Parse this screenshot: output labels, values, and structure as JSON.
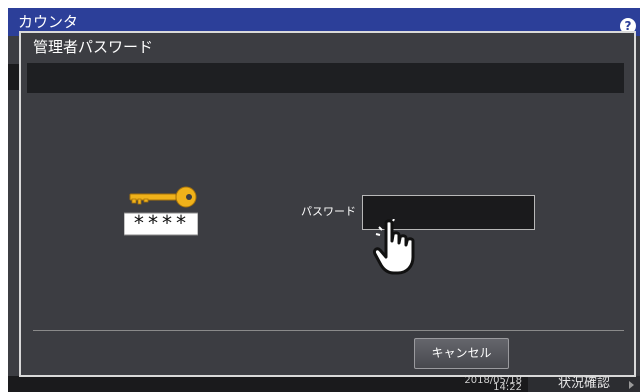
{
  "background": {
    "title": "カウンタ",
    "help_label": "?",
    "status": {
      "date": "2018/05/18",
      "time": "14:22",
      "check_label": "状況確認"
    }
  },
  "dialog": {
    "title": "管理者パスワード",
    "key_mask": "****",
    "password_label": "パスワード",
    "password_value": "",
    "cancel_label": "キャンセル"
  },
  "colors": {
    "titlebar": "#2c3f99",
    "panel": "#3c3d42",
    "band": "#1e1f22",
    "key": "#f0b21a"
  }
}
